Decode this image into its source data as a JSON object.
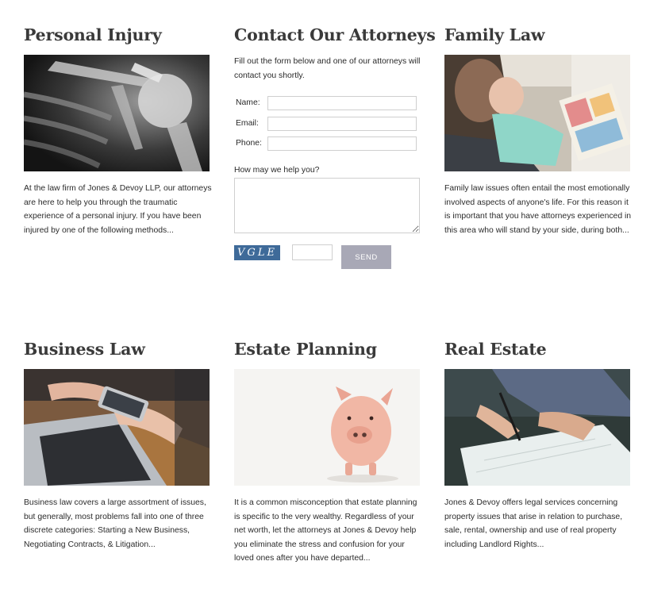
{
  "cards": {
    "personal_injury": {
      "title": "Personal Injury",
      "blurb": "At the law firm of Jones & Devoy LLP, our attorneys are here to help you through the traumatic experience of a personal injury. If you have been injured by one of the following methods..."
    },
    "family_law": {
      "title": "Family Law",
      "blurb": "Family law issues often entail the most emotionally involved aspects of anyone's life. For this reason it is important that you have attorneys experienced in this area who will stand by your side, during both..."
    },
    "business_law": {
      "title": "Business Law",
      "blurb": "Business law covers a large assortment of issues, but generally, most problems fall into one of three discrete categories: Starting a New Business, Negotiating Contracts, & Litigation..."
    },
    "estate_planning": {
      "title": "Estate Planning",
      "blurb": "It is a common misconception that estate planning is specific to the very wealthy. Regardless of your net worth, let the attorneys at Jones & Devoy help you eliminate the stress and confusion for your loved ones after you have departed..."
    },
    "real_estate": {
      "title": "Real Estate",
      "blurb": "Jones & Devoy offers legal services concerning property issues that arise in relation to purchase, sale, rental, ownership and use of real property including Landlord Rights..."
    }
  },
  "contact": {
    "title": "Contact Our Attorneys",
    "intro": "Fill out the form below and one of our attorneys will contact you shortly.",
    "name_label": "Name:",
    "email_label": "Email:",
    "phone_label": "Phone:",
    "help_label": "How may we help you?",
    "captcha_text": "VGLE",
    "send_label": "SEND"
  },
  "colors": {
    "captcha_bg": "#3e6a99",
    "send_bg": "#a8a8b6",
    "heading": "#3a3a3a"
  }
}
